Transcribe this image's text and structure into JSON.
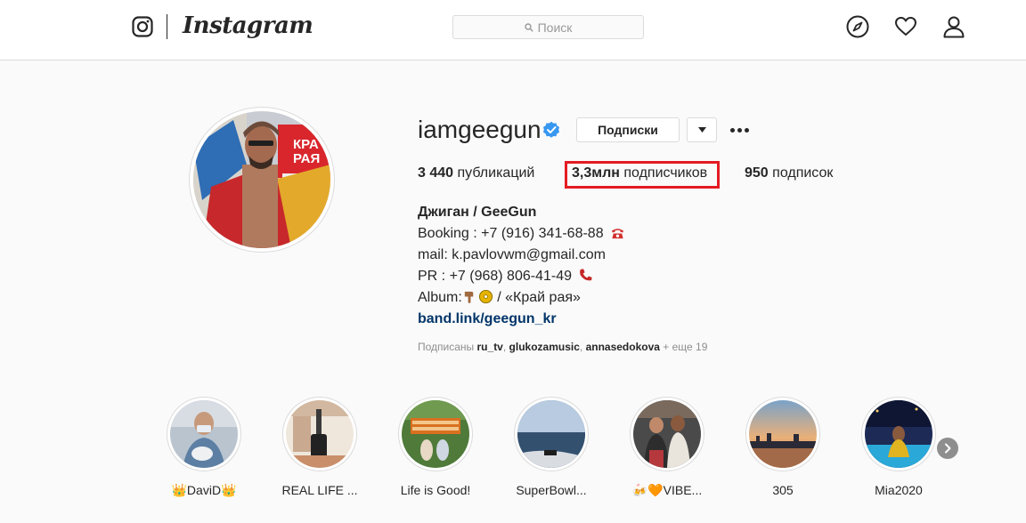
{
  "nav": {
    "logo_text": "Instagram",
    "search_placeholder": "Поиск"
  },
  "profile": {
    "username": "iamgeegun",
    "follow_button": "Подписки",
    "stats": {
      "posts_count": "3 440",
      "posts_label": "публикаций",
      "followers_count": "3,3млн",
      "followers_label": "подписчиков",
      "following_count": "950",
      "following_label": "подписок"
    },
    "bio": {
      "name": "Джиган / GeeGun",
      "booking": "Booking : +7 (916) 341-68-88",
      "mail": "mail: k.pavlovwm@gmail.com",
      "pr": "PR : +7 (968) 806-41-49",
      "album_prefix": "Album:",
      "album_title": "/ «Край рая»",
      "link": "band.link/geegun_kr"
    },
    "followed_by": {
      "prefix": "Подписаны",
      "user1": "ru_tv",
      "user2": "glukozamusic",
      "user3": "annasedokova",
      "more": "+ еще 19"
    }
  },
  "highlights": [
    {
      "label": "👑DaviD👑"
    },
    {
      "label": "REAL LIFE ..."
    },
    {
      "label": "Life is Good!"
    },
    {
      "label": "SuperBowl..."
    },
    {
      "label": "🍻🧡VIBE..."
    },
    {
      "label": "305"
    },
    {
      "label": "Mia2020"
    }
  ],
  "colors": {
    "highlight_box": "#e31b23",
    "link": "#003569",
    "verified": "#3897f0"
  }
}
